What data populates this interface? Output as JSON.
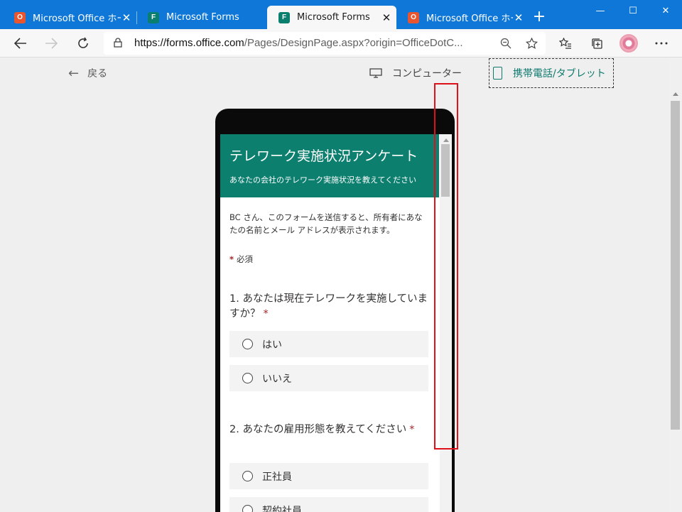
{
  "browser": {
    "tabs": [
      {
        "title": "Microsoft Office ホーム",
        "icon": "office-icon",
        "active": false
      },
      {
        "title": "Microsoft Forms",
        "icon": "forms-icon",
        "active": false
      },
      {
        "title": "Microsoft Forms",
        "icon": "forms-icon",
        "active": true
      },
      {
        "title": "Microsoft Office ホーム",
        "icon": "office-icon",
        "active": false
      }
    ],
    "new_tab": "+",
    "window_controls": {
      "minimize": "—",
      "maximize": "☐",
      "close": "✕"
    },
    "address": {
      "domain": "https://forms.office.com",
      "path": "/Pages/DesignPage.aspx?origin=OfficeDotC..."
    },
    "accent_color": "#0f77d7"
  },
  "toolbar": {
    "back_label": "戻る",
    "computer_label": "コンピューター",
    "mobile_label": "携帯電話/タブレット",
    "selected_view": "携帯電話/タブレット"
  },
  "form": {
    "title": "テレワーク実施状況アンケート",
    "subtitle": "あなたの会社のテレワーク実施状況を教えてください",
    "notice": "BC さん、このフォームを送信すると、所有者にあなたの名前とメール アドレスが表示されます。",
    "required_star": "*",
    "required_label": "必須",
    "header_color": "#0d7f6f",
    "questions": [
      {
        "title": "1. あなたは現在テレワークを実施していますか？",
        "required_mark": "*",
        "options": [
          "はい",
          "いいえ"
        ]
      },
      {
        "title": "2. あなたの雇用形態を教えてください",
        "required_mark": "*",
        "options": [
          "正社員",
          "契約社員"
        ]
      }
    ]
  },
  "highlight_color": "#e0101a"
}
